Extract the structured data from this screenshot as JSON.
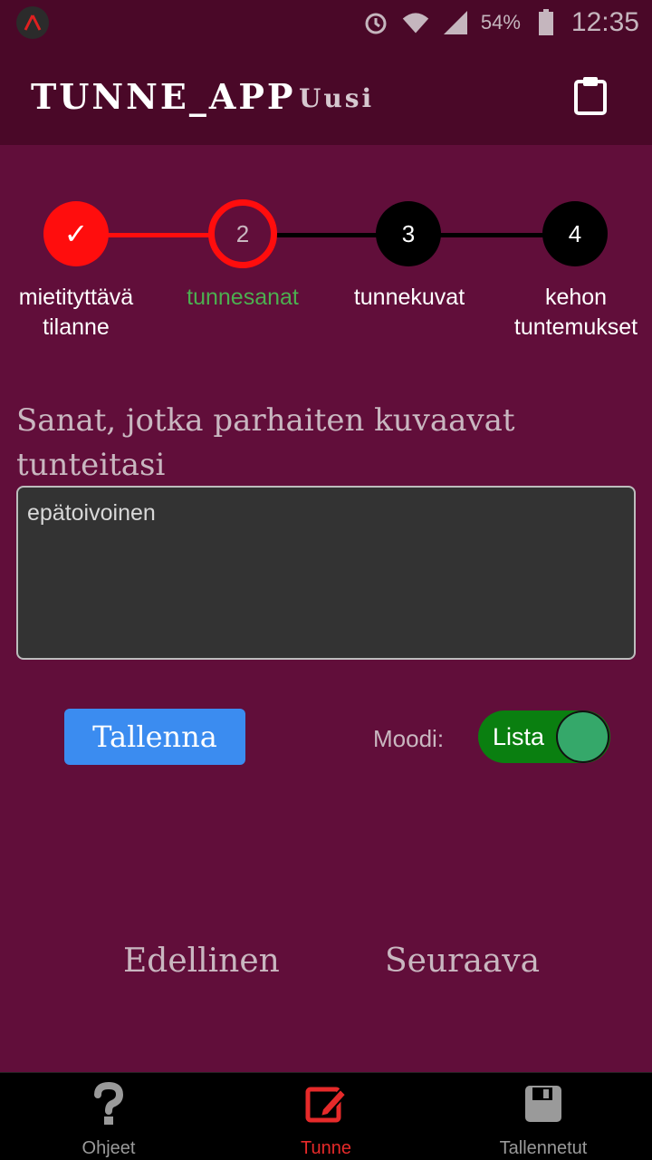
{
  "status_bar": {
    "battery_percent": "54%",
    "time": "12:35"
  },
  "app_bar": {
    "title": "TUNNE_APP",
    "subtitle": "Uusi",
    "action_icon": "clipboard-icon"
  },
  "stepper": {
    "steps": [
      {
        "number": "✓",
        "label_line1": "mietityttävä",
        "label_line2": "tilanne",
        "state": "completed"
      },
      {
        "number": "2",
        "label_line1": "tunnesanat",
        "label_line2": "",
        "state": "active"
      },
      {
        "number": "3",
        "label_line1": "tunnekuvat",
        "label_line2": "",
        "state": "pending"
      },
      {
        "number": "4",
        "label_line1": "kehon",
        "label_line2": "tuntemukset",
        "state": "pending"
      }
    ]
  },
  "form": {
    "prompt_line1": "Sanat, jotka parhaiten kuvaavat",
    "prompt_line2": "tunteitasi",
    "input_value": "epätoivoinen"
  },
  "actions": {
    "save_label": "Tallenna",
    "mode_label": "Moodi:",
    "mode_value": "Lista"
  },
  "navigation": {
    "prev_label": "Edellinen",
    "next_label": "Seuraava"
  },
  "tabs": [
    {
      "label": "Ohjeet",
      "icon": "question-icon"
    },
    {
      "label": "Tunne",
      "icon": "edit-icon",
      "active": true
    },
    {
      "label": "Tallennetut",
      "icon": "floppy-disk-icon"
    }
  ],
  "colors": {
    "background": "#610e3a",
    "app_bar": "#4a0828",
    "accent_red": "#ff0d0d",
    "active_step_label": "#4caf50",
    "save_button": "#3b8cf0",
    "toggle": "#0a7f10"
  }
}
